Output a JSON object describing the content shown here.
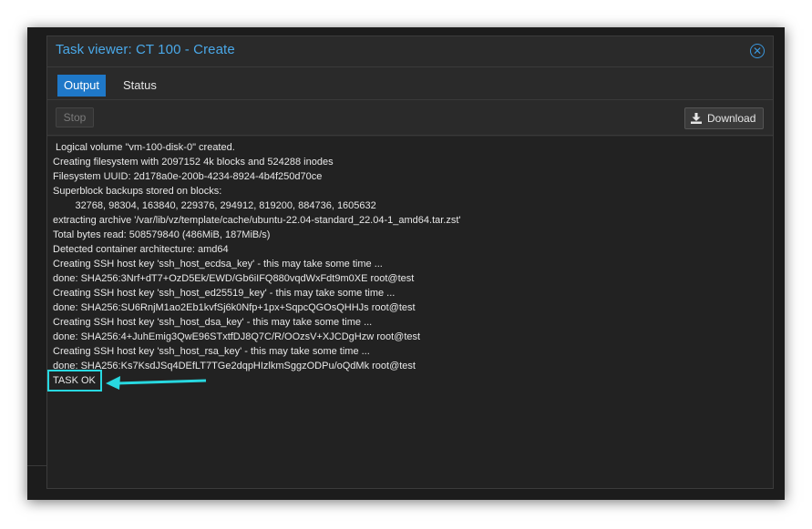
{
  "window": {
    "title": "Task viewer: CT 100 - Create"
  },
  "tabs": [
    {
      "label": "Output",
      "active": true
    },
    {
      "label": "Status",
      "active": false
    }
  ],
  "toolbar": {
    "stop_label": "Stop",
    "download_label": "Download"
  },
  "log": [
    " Logical volume \"vm-100-disk-0\" created.",
    "Creating filesystem with 2097152 4k blocks and 524288 inodes",
    "Filesystem UUID: 2d178a0e-200b-4234-8924-4b4f250d70ce",
    "Superblock backups stored on blocks:",
    "        32768, 98304, 163840, 229376, 294912, 819200, 884736, 1605632",
    "extracting archive '/var/lib/vz/template/cache/ubuntu-22.04-standard_22.04-1_amd64.tar.zst'",
    "Total bytes read: 508579840 (486MiB, 187MiB/s)",
    "Detected container architecture: amd64",
    "Creating SSH host key 'ssh_host_ecdsa_key' - this may take some time ...",
    "done: SHA256:3Nrf+dT7+OzD5Ek/EWD/Gb6iIFQ880vqdWxFdt9m0XE root@test",
    "Creating SSH host key 'ssh_host_ed25519_key' - this may take some time ...",
    "done: SHA256:SU6RnjM1ao2Eb1kvfSj6k0Nfp+1px+SqpcQGOsQHHJs root@test",
    "Creating SSH host key 'ssh_host_dsa_key' - this may take some time ...",
    "done: SHA256:4+JuhEmig3QwE96STxtfDJ8Q7C/R/OOzsV+XJCDgHzw root@test",
    "Creating SSH host key 'ssh_host_rsa_key' - this may take some time ...",
    "done: SHA256:Ks7KsdJSq4DEfLT7TGe2dqpHIzlkmSggzODPu/oQdMk root@test",
    "TASK OK"
  ],
  "colors": {
    "title": "#4aa8e8",
    "active_tab": "#1f78c8",
    "annotation": "#28d8e0"
  },
  "icons": [
    "close-circle-icon",
    "download-icon",
    "annotation-arrow"
  ]
}
